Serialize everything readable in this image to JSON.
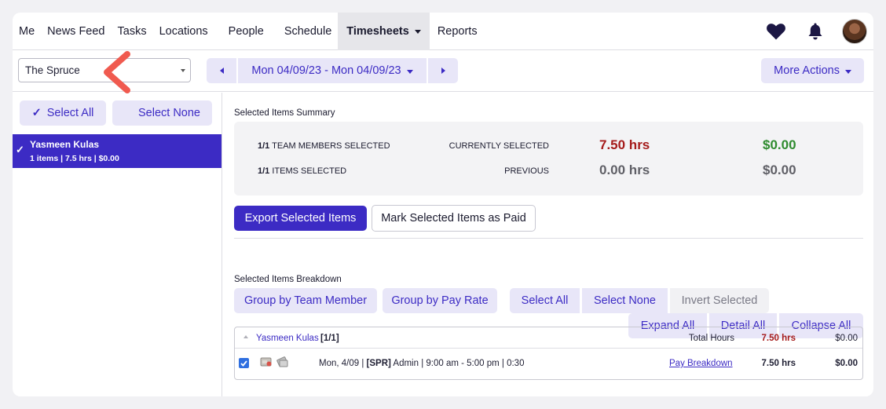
{
  "nav": {
    "items": [
      "Me",
      "News Feed",
      "Tasks",
      "Locations",
      "People",
      "Schedule",
      "Timesheets",
      "Reports"
    ],
    "active": "Timesheets",
    "icons": [
      "heart-icon",
      "bell-icon"
    ]
  },
  "toolbar": {
    "location_value": "The Spruce",
    "date_range": "Mon 04/09/23 - Mon 04/09/23",
    "more_actions": "More Actions"
  },
  "left": {
    "select_all": "Select All",
    "select_all_check": "✓",
    "select_none": "Select None",
    "member": {
      "name": "Yasmeen Kulas",
      "sub": "1 items | 7.5 hrs | $0.00",
      "check": "✓"
    }
  },
  "summary": {
    "title": "Selected Items Summary",
    "team_count": "1/1",
    "team_label": "TEAM MEMBERS SELECTED",
    "items_count": "1/1",
    "items_label": "ITEMS SELECTED",
    "current_label": "CURRENTLY SELECTED",
    "previous_label": "PREVIOUS",
    "current_hours": "7.50 hrs",
    "current_pay": "$0.00",
    "previous_hours": "0.00 hrs",
    "previous_pay": "$0.00",
    "colors": {
      "hours": "#a51b1b",
      "pay": "#2e8b2e",
      "muted": "#5f5f66"
    }
  },
  "actions": {
    "export": "Export Selected Items",
    "mark_paid": "Mark Selected Items as Paid"
  },
  "breakdown": {
    "title": "Selected Items Breakdown",
    "group_member": "Group by Team Member",
    "group_rate": "Group by Pay Rate",
    "select_all": "Select All",
    "select_none": "Select None",
    "invert": "Invert Selected",
    "expand_all": "Expand All",
    "detail_all": "Detail All",
    "collapse_all": "Collapse All"
  },
  "table": {
    "group": {
      "name": "Yasmeen Kulas",
      "count": "[1/1]",
      "total_label": "Total Hours",
      "hours": "7.50 hrs",
      "pay": "$0.00"
    },
    "row": {
      "prefix": "Mon, 4/09 | ",
      "code": "[SPR]",
      "suffix": " Admin | 9:00 am - 5:00 pm | 0:30",
      "link": "Pay Breakdown",
      "hours": "7.50 hrs",
      "pay": "$0.00"
    }
  },
  "accent": "#3c2bc4",
  "annotation_color": "#f05a4f"
}
